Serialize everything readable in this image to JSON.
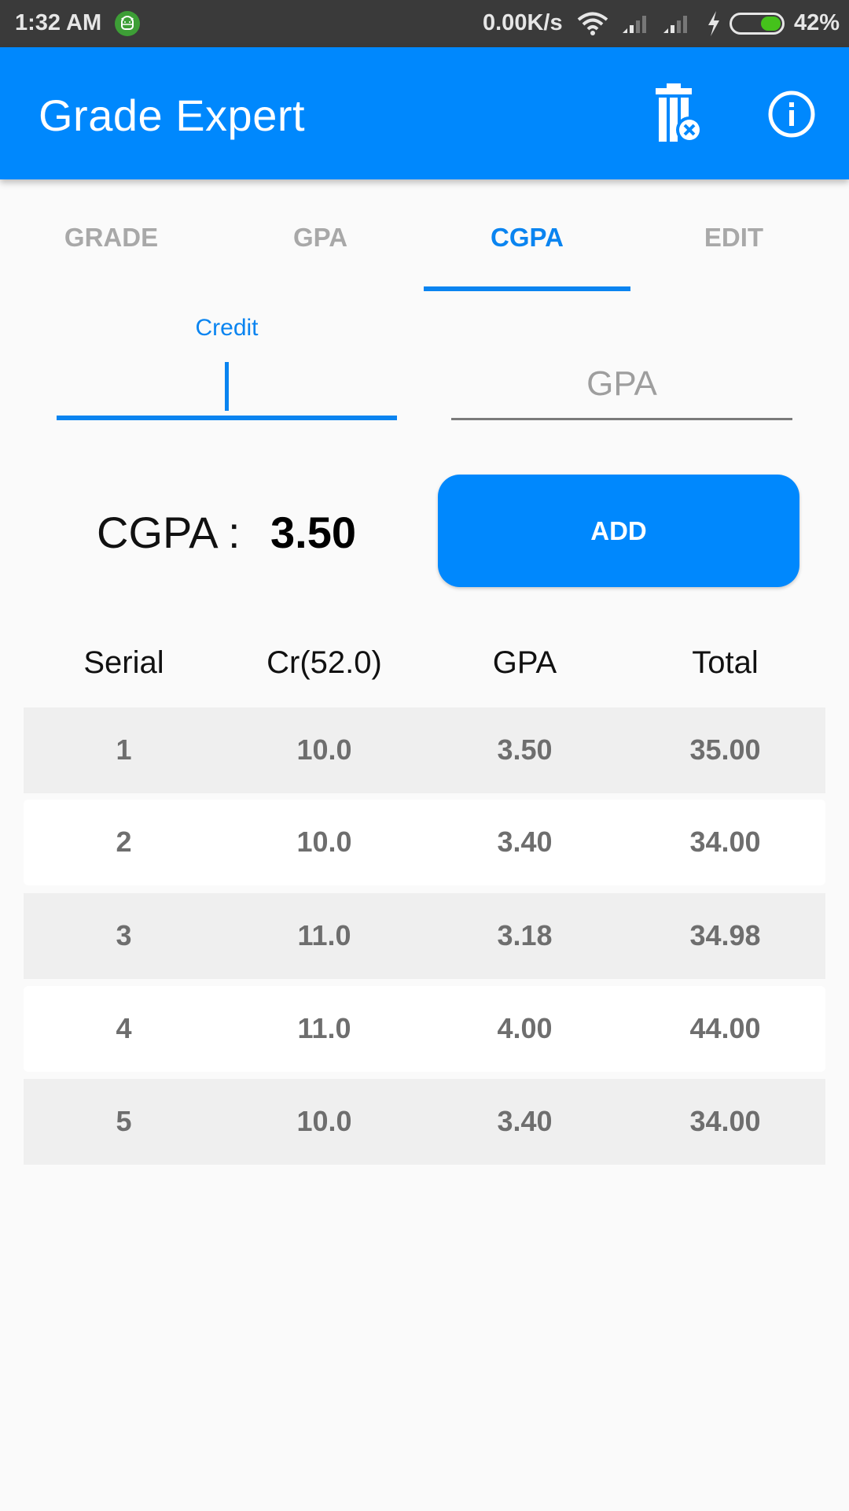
{
  "status_bar": {
    "time": "1:32 AM",
    "network_speed": "0.00K/s",
    "battery_percent": "42%",
    "battery_level": 0.42,
    "icons": [
      "android-notification-icon",
      "wifi-icon",
      "signal-icon",
      "signal-icon",
      "charging-icon",
      "battery-icon"
    ]
  },
  "app_bar": {
    "title": "Grade Expert",
    "actions": [
      {
        "name": "clear-all",
        "icon": "trash-clear-icon"
      },
      {
        "name": "info",
        "icon": "info-icon"
      }
    ]
  },
  "tabs": [
    {
      "label": "GRADE",
      "active": false
    },
    {
      "label": "GPA",
      "active": false
    },
    {
      "label": "CGPA",
      "active": true
    },
    {
      "label": "EDIT",
      "active": false
    }
  ],
  "form": {
    "credit": {
      "label": "Credit",
      "value": "",
      "placeholder": ""
    },
    "gpa": {
      "value": "",
      "placeholder": "GPA"
    }
  },
  "result": {
    "label": "CGPA :",
    "value": "3.50"
  },
  "add_button": {
    "label": "ADD"
  },
  "table": {
    "headers": [
      "Serial",
      "Cr(52.0)",
      "GPA",
      "Total"
    ],
    "rows": [
      [
        "1",
        "10.0",
        "3.50",
        "35.00"
      ],
      [
        "2",
        "10.0",
        "3.40",
        "34.00"
      ],
      [
        "3",
        "11.0",
        "3.18",
        "34.98"
      ],
      [
        "4",
        "11.0",
        "4.00",
        "44.00"
      ],
      [
        "5",
        "10.0",
        "3.40",
        "34.00"
      ]
    ]
  },
  "colors": {
    "primary": "#0088fd",
    "accent": "#0a84f0",
    "status_bar": "#3a3a3a",
    "row_alt": "#efefef",
    "cell_text": "#6e6e6e"
  }
}
